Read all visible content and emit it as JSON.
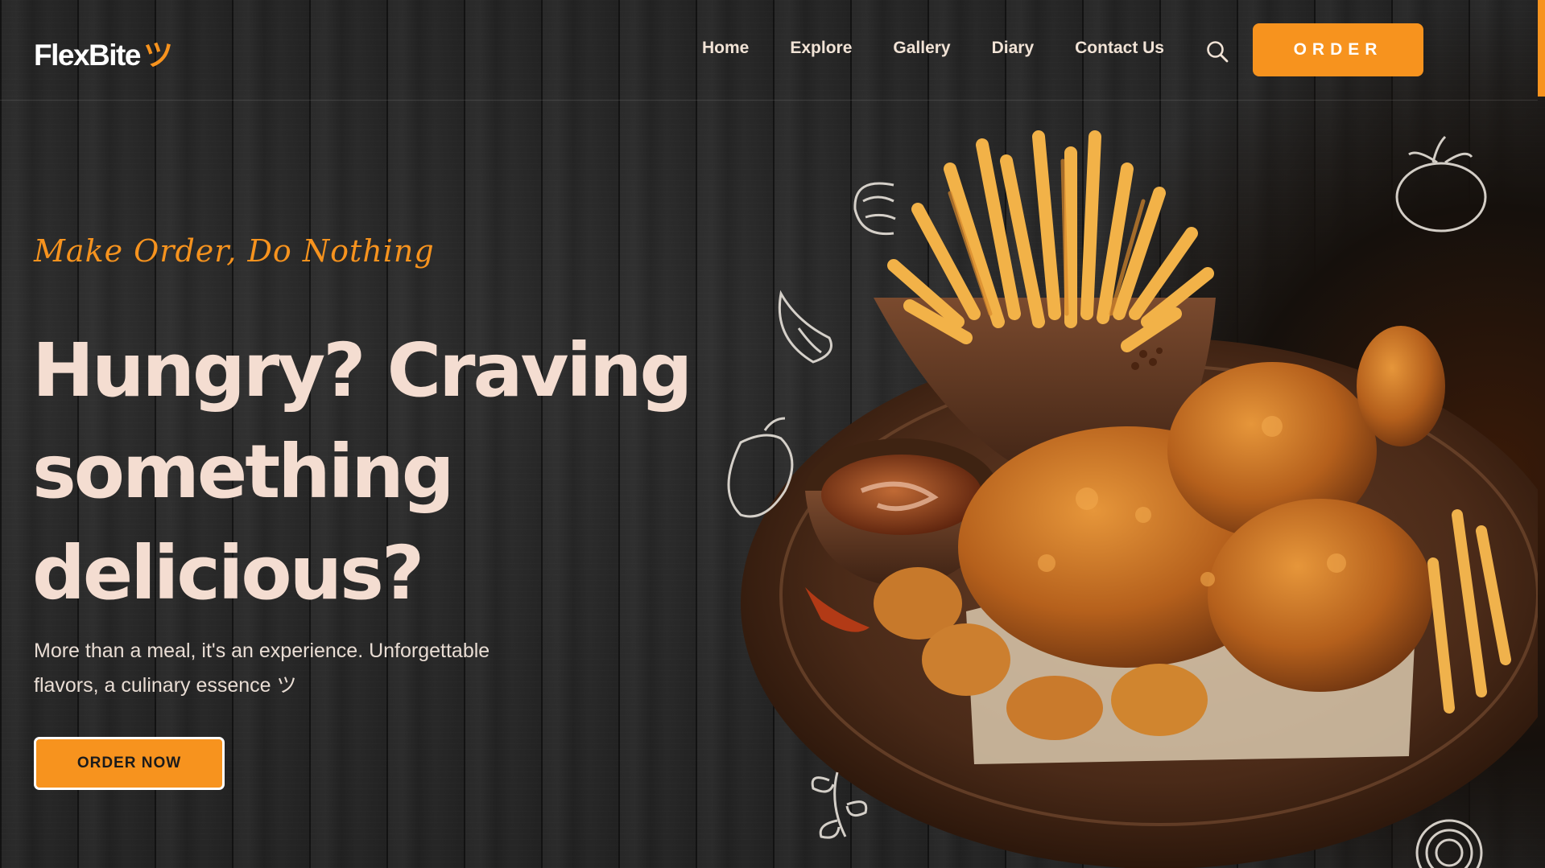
{
  "brand": {
    "name": "FlexBite",
    "smile": "ツ",
    "accent_color": "#f7931e"
  },
  "nav": {
    "items": [
      "Home",
      "Explore",
      "Gallery",
      "Diary",
      "Contact Us"
    ],
    "search_icon": "search-icon",
    "order_label": "ORDER"
  },
  "hero": {
    "tagline": "Make Order, Do Nothing",
    "headline_line1": "Hungry? Craving",
    "headline_line2": "something",
    "headline_line3": "delicious?",
    "description_line1": "More than a meal, it's an experience. Unforgettable",
    "description_line2": "flavors, a culinary essence ツ",
    "cta_label": "ORDER NOW"
  },
  "illustration": {
    "subject": "fried-chicken-fries-platter",
    "doodle_icons": [
      "tomato-doodle-icon",
      "garlic-doodle-icon",
      "bell-pepper-doodle-icon",
      "shrimp-doodle-icon",
      "herb-doodle-icon",
      "onion-doodle-icon"
    ]
  }
}
